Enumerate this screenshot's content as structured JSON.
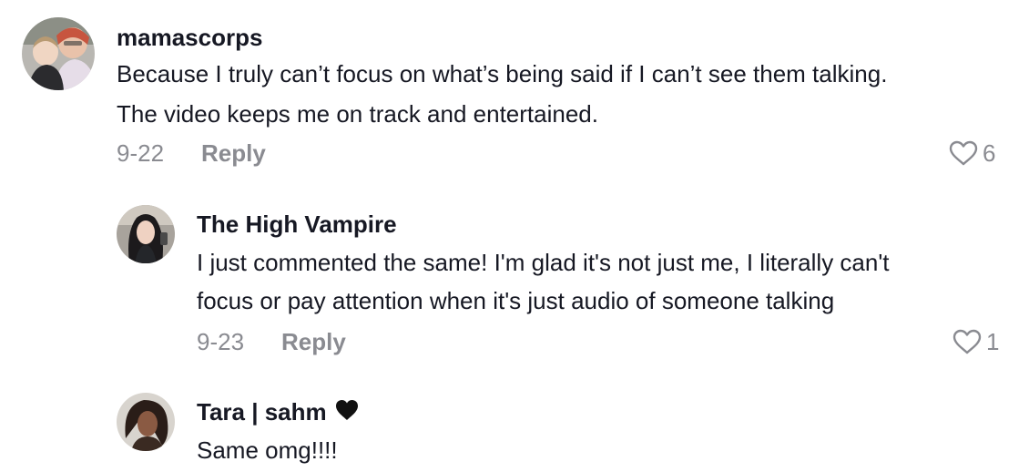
{
  "comments": [
    {
      "username": "mamascorps",
      "lines": [
        "Because I truly can’t focus on what’s being said if I can’t see them talking.",
        "The video keeps me on track and entertained."
      ],
      "date": "9-22",
      "reply_label": "Reply",
      "likes": "6"
    },
    {
      "username": "The High Vampire",
      "lines": [
        "I just commented the same! I'm glad it's not just me, I literally can't",
        "focus or pay attention when it's just audio of someone talking"
      ],
      "date": "9-23",
      "reply_label": "Reply",
      "likes": "1"
    },
    {
      "username": "Tara | sahm",
      "username_emoji": "black-heart-icon",
      "lines": [
        "Same omg!!!!"
      ]
    }
  ]
}
